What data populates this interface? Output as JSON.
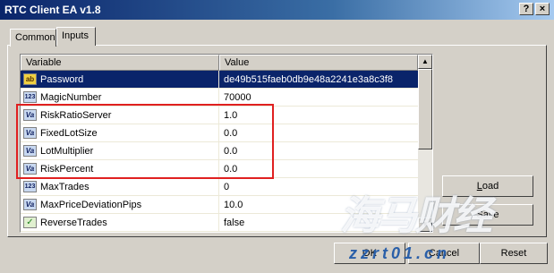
{
  "window": {
    "title": "RTC Client EA v1.8",
    "help_glyph": "?",
    "close_glyph": "×"
  },
  "tabs": [
    {
      "label": "Common"
    },
    {
      "label": "Inputs"
    }
  ],
  "grid": {
    "columns": [
      "Variable",
      "Value"
    ],
    "rows": [
      {
        "icon": "ab",
        "name": "Password",
        "value": "de49b515faeb0db9e48a2241e3a8c3f8"
      },
      {
        "icon": "123",
        "name": "MagicNumber",
        "value": "70000"
      },
      {
        "icon": "Va",
        "name": "RiskRatioServer",
        "value": "1.0"
      },
      {
        "icon": "Va",
        "name": "FixedLotSize",
        "value": "0.0"
      },
      {
        "icon": "Va",
        "name": "LotMultiplier",
        "value": "0.0"
      },
      {
        "icon": "Va",
        "name": "RiskPercent",
        "value": "0.0"
      },
      {
        "icon": "123",
        "name": "MaxTrades",
        "value": "0"
      },
      {
        "icon": "Va",
        "name": "MaxPriceDeviationPips",
        "value": "10.0"
      },
      {
        "icon": "✓",
        "name": "ReverseTrades",
        "value": "false"
      }
    ],
    "selected_row": 0
  },
  "buttons": {
    "load_first": "L",
    "load_rest": "oad",
    "save": "Save",
    "ok": "OK",
    "cancel": "Cancel",
    "reset": "Reset"
  },
  "watermark": {
    "main": "海马财经",
    "url": "zzrt01.cn"
  },
  "colors": {
    "selection": "#0a246a",
    "highlight": "#e02020",
    "titlebar": "#0a246a"
  }
}
